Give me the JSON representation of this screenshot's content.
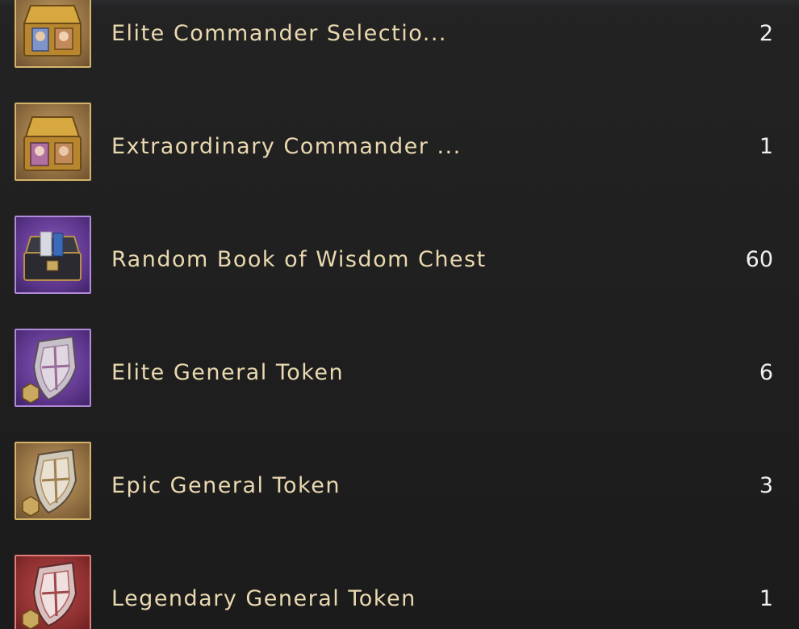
{
  "items": [
    {
      "name": "Elite Commander Selectio...",
      "count": "2",
      "icon": "gold-chest-icon",
      "rarity_color": "#d4b36b"
    },
    {
      "name": "Extraordinary Commander ...",
      "count": "1",
      "icon": "gold-chest-icon",
      "rarity_color": "#d4b36b"
    },
    {
      "name": "Random Book of Wisdom Chest",
      "count": "60",
      "icon": "book-chest-icon",
      "rarity_color": "#b18ad8"
    },
    {
      "name": "Elite General Token",
      "count": "6",
      "icon": "shield-token-icon",
      "rarity_color": "#b18ad8"
    },
    {
      "name": "Epic General Token",
      "count": "3",
      "icon": "shield-token-icon",
      "rarity_color": "#d4b36b"
    },
    {
      "name": "Legendary General Token",
      "count": "1",
      "icon": "shield-token-icon",
      "rarity_color": "#e07c7c"
    }
  ]
}
